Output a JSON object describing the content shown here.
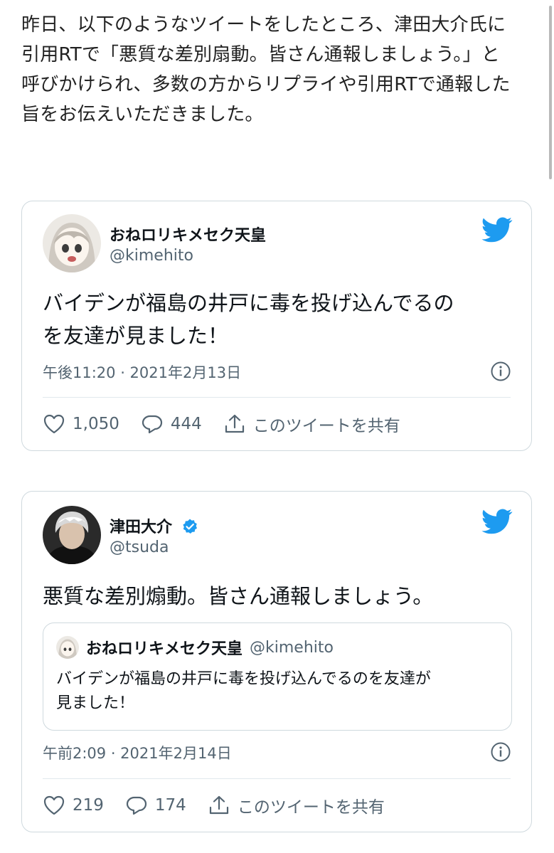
{
  "intro": {
    "lines": [
      "昨日、以下のようなツイートをしたところ、津田大介氏に",
      "引用RTで「悪質な差別扇動。皆さん通報しましょう。」と",
      "呼びかけられ、多数の方からリプライや引用RTで通報した",
      "旨をお伝えいただきました。"
    ]
  },
  "colors": {
    "twitter_blue": "#1d9bf0",
    "text_primary": "#0f1419",
    "text_secondary": "#536471",
    "border": "#cfd9de"
  },
  "tweets": [
    {
      "name": "おねロリキメセク天皇",
      "handle": "@kimehito",
      "verified": false,
      "text_lines": [
        "バイデンが福島の井戸に毒を投げ込んでるの",
        "を友達が見ました！"
      ],
      "meta": "午後11:20 · 2021年2月13日",
      "likes": "1,050",
      "replies": "444",
      "share_label": "このツイートを共有",
      "icons": [
        "twitter-bird-icon",
        "info-icon",
        "heart-icon",
        "reply-icon",
        "share-icon"
      ]
    },
    {
      "name": "津田大介",
      "handle": "@tsuda",
      "verified": true,
      "text_lines": [
        "悪質な差別煽動。皆さん通報しましょう。"
      ],
      "meta": "午前2:09 · 2021年2月14日",
      "likes": "219",
      "replies": "174",
      "share_label": "このツイートを共有",
      "quoted": {
        "name": "おねロリキメセク天皇",
        "handle": "@kimehito",
        "text_lines": [
          "バイデンが福島の井戸に毒を投げ込んでるのを友達が",
          "見ました！"
        ]
      }
    }
  ]
}
